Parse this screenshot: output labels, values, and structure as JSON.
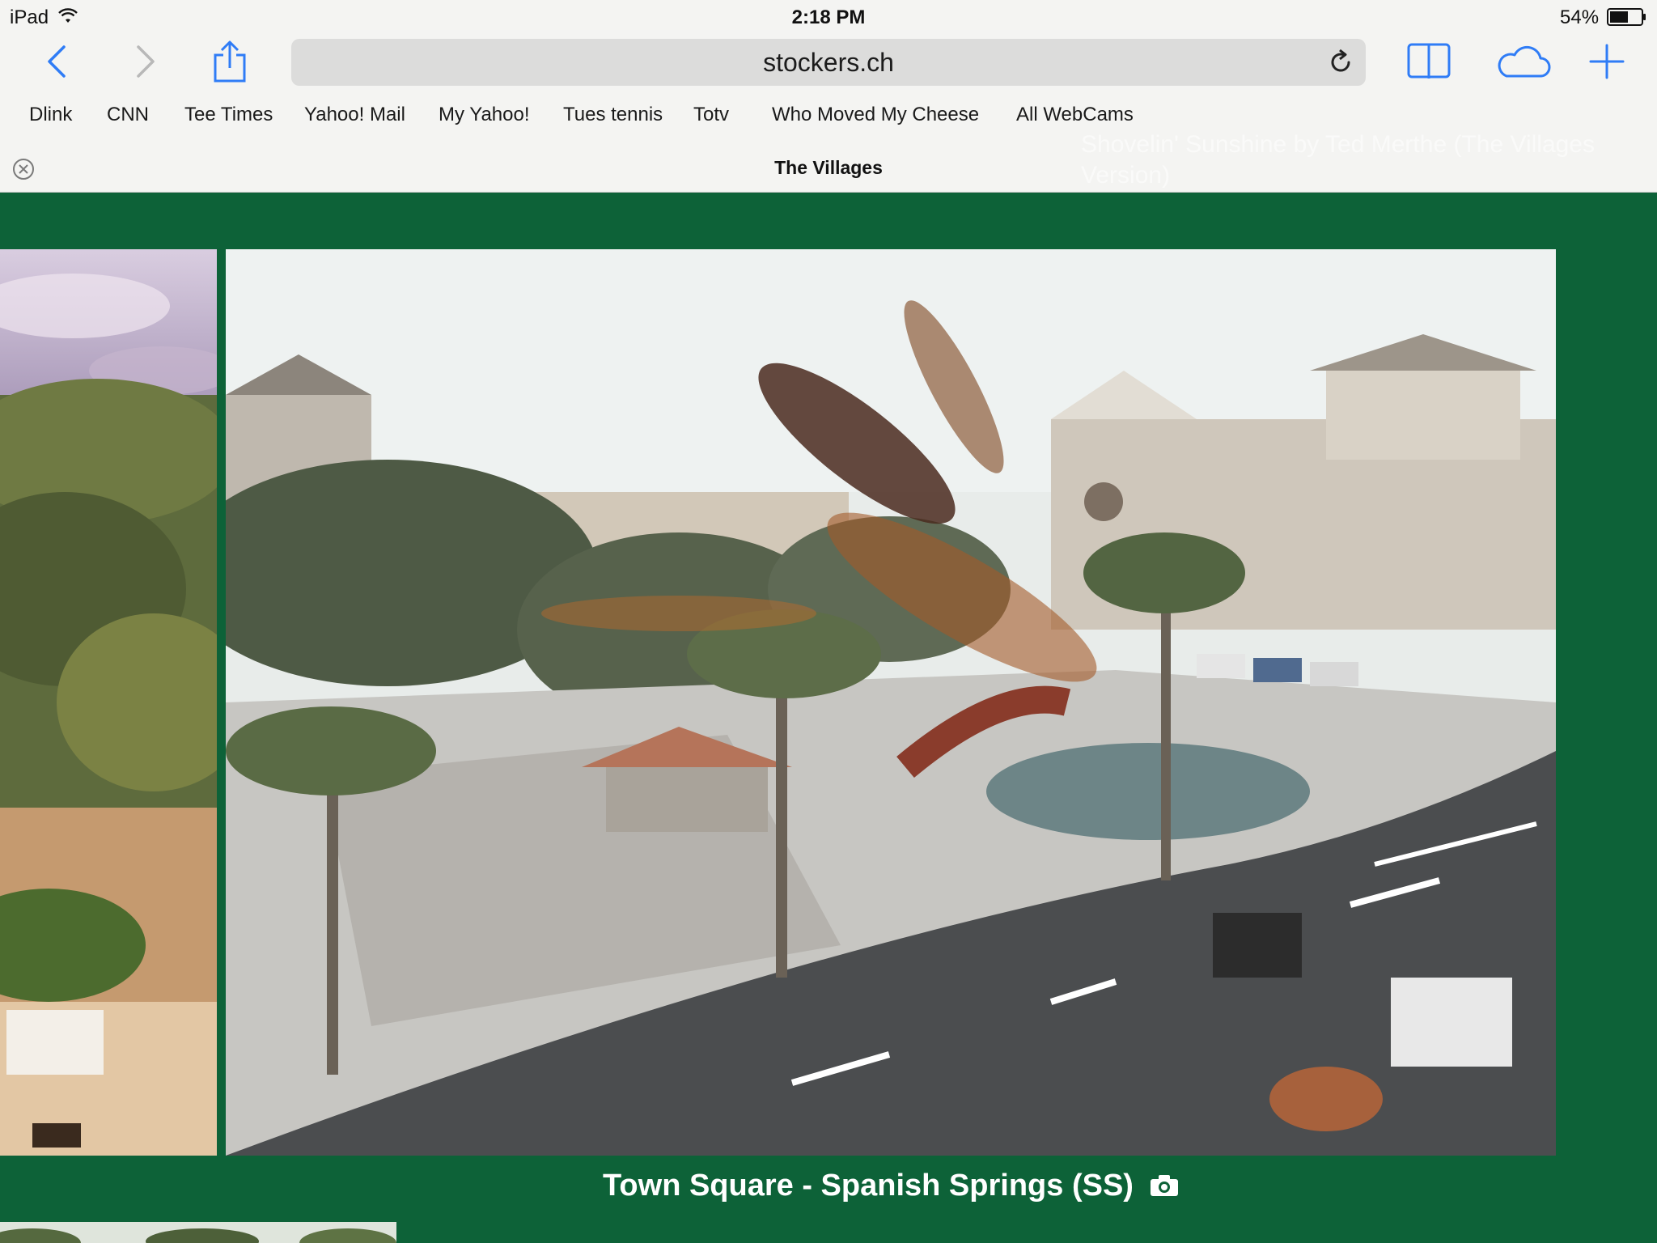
{
  "status_bar": {
    "device": "iPad",
    "time": "2:18 PM",
    "battery": "54%"
  },
  "toolbar": {
    "url": "stockers.ch",
    "icons": [
      "back-icon",
      "forward-icon",
      "share-icon",
      "reload-icon",
      "bookmarks-book-icon",
      "icloud-icon",
      "plus-icon"
    ]
  },
  "bookmarks": [
    {
      "label": "Dlink"
    },
    {
      "label": "CNN"
    },
    {
      "label": "Tee Times"
    },
    {
      "label": "Yahoo! Mail"
    },
    {
      "label": "My Yahoo!"
    },
    {
      "label": "Tues tennis"
    },
    {
      "label": "Totv"
    },
    {
      "label": "Who Moved My Cheese"
    },
    {
      "label": "All WebCams"
    }
  ],
  "tab": {
    "title": "The Villages",
    "background_tab_title": "Shovelin' Sunshine by Ted Merthe (The Villages Version)"
  },
  "page": {
    "background_color": "#0d6238",
    "webcam_caption": "Town Square - Spanish Springs (SS)",
    "caption_icon": "camera-icon"
  },
  "colors": {
    "ios_blue": "#2f7cf6",
    "chrome_bg": "#f4f4f2"
  }
}
